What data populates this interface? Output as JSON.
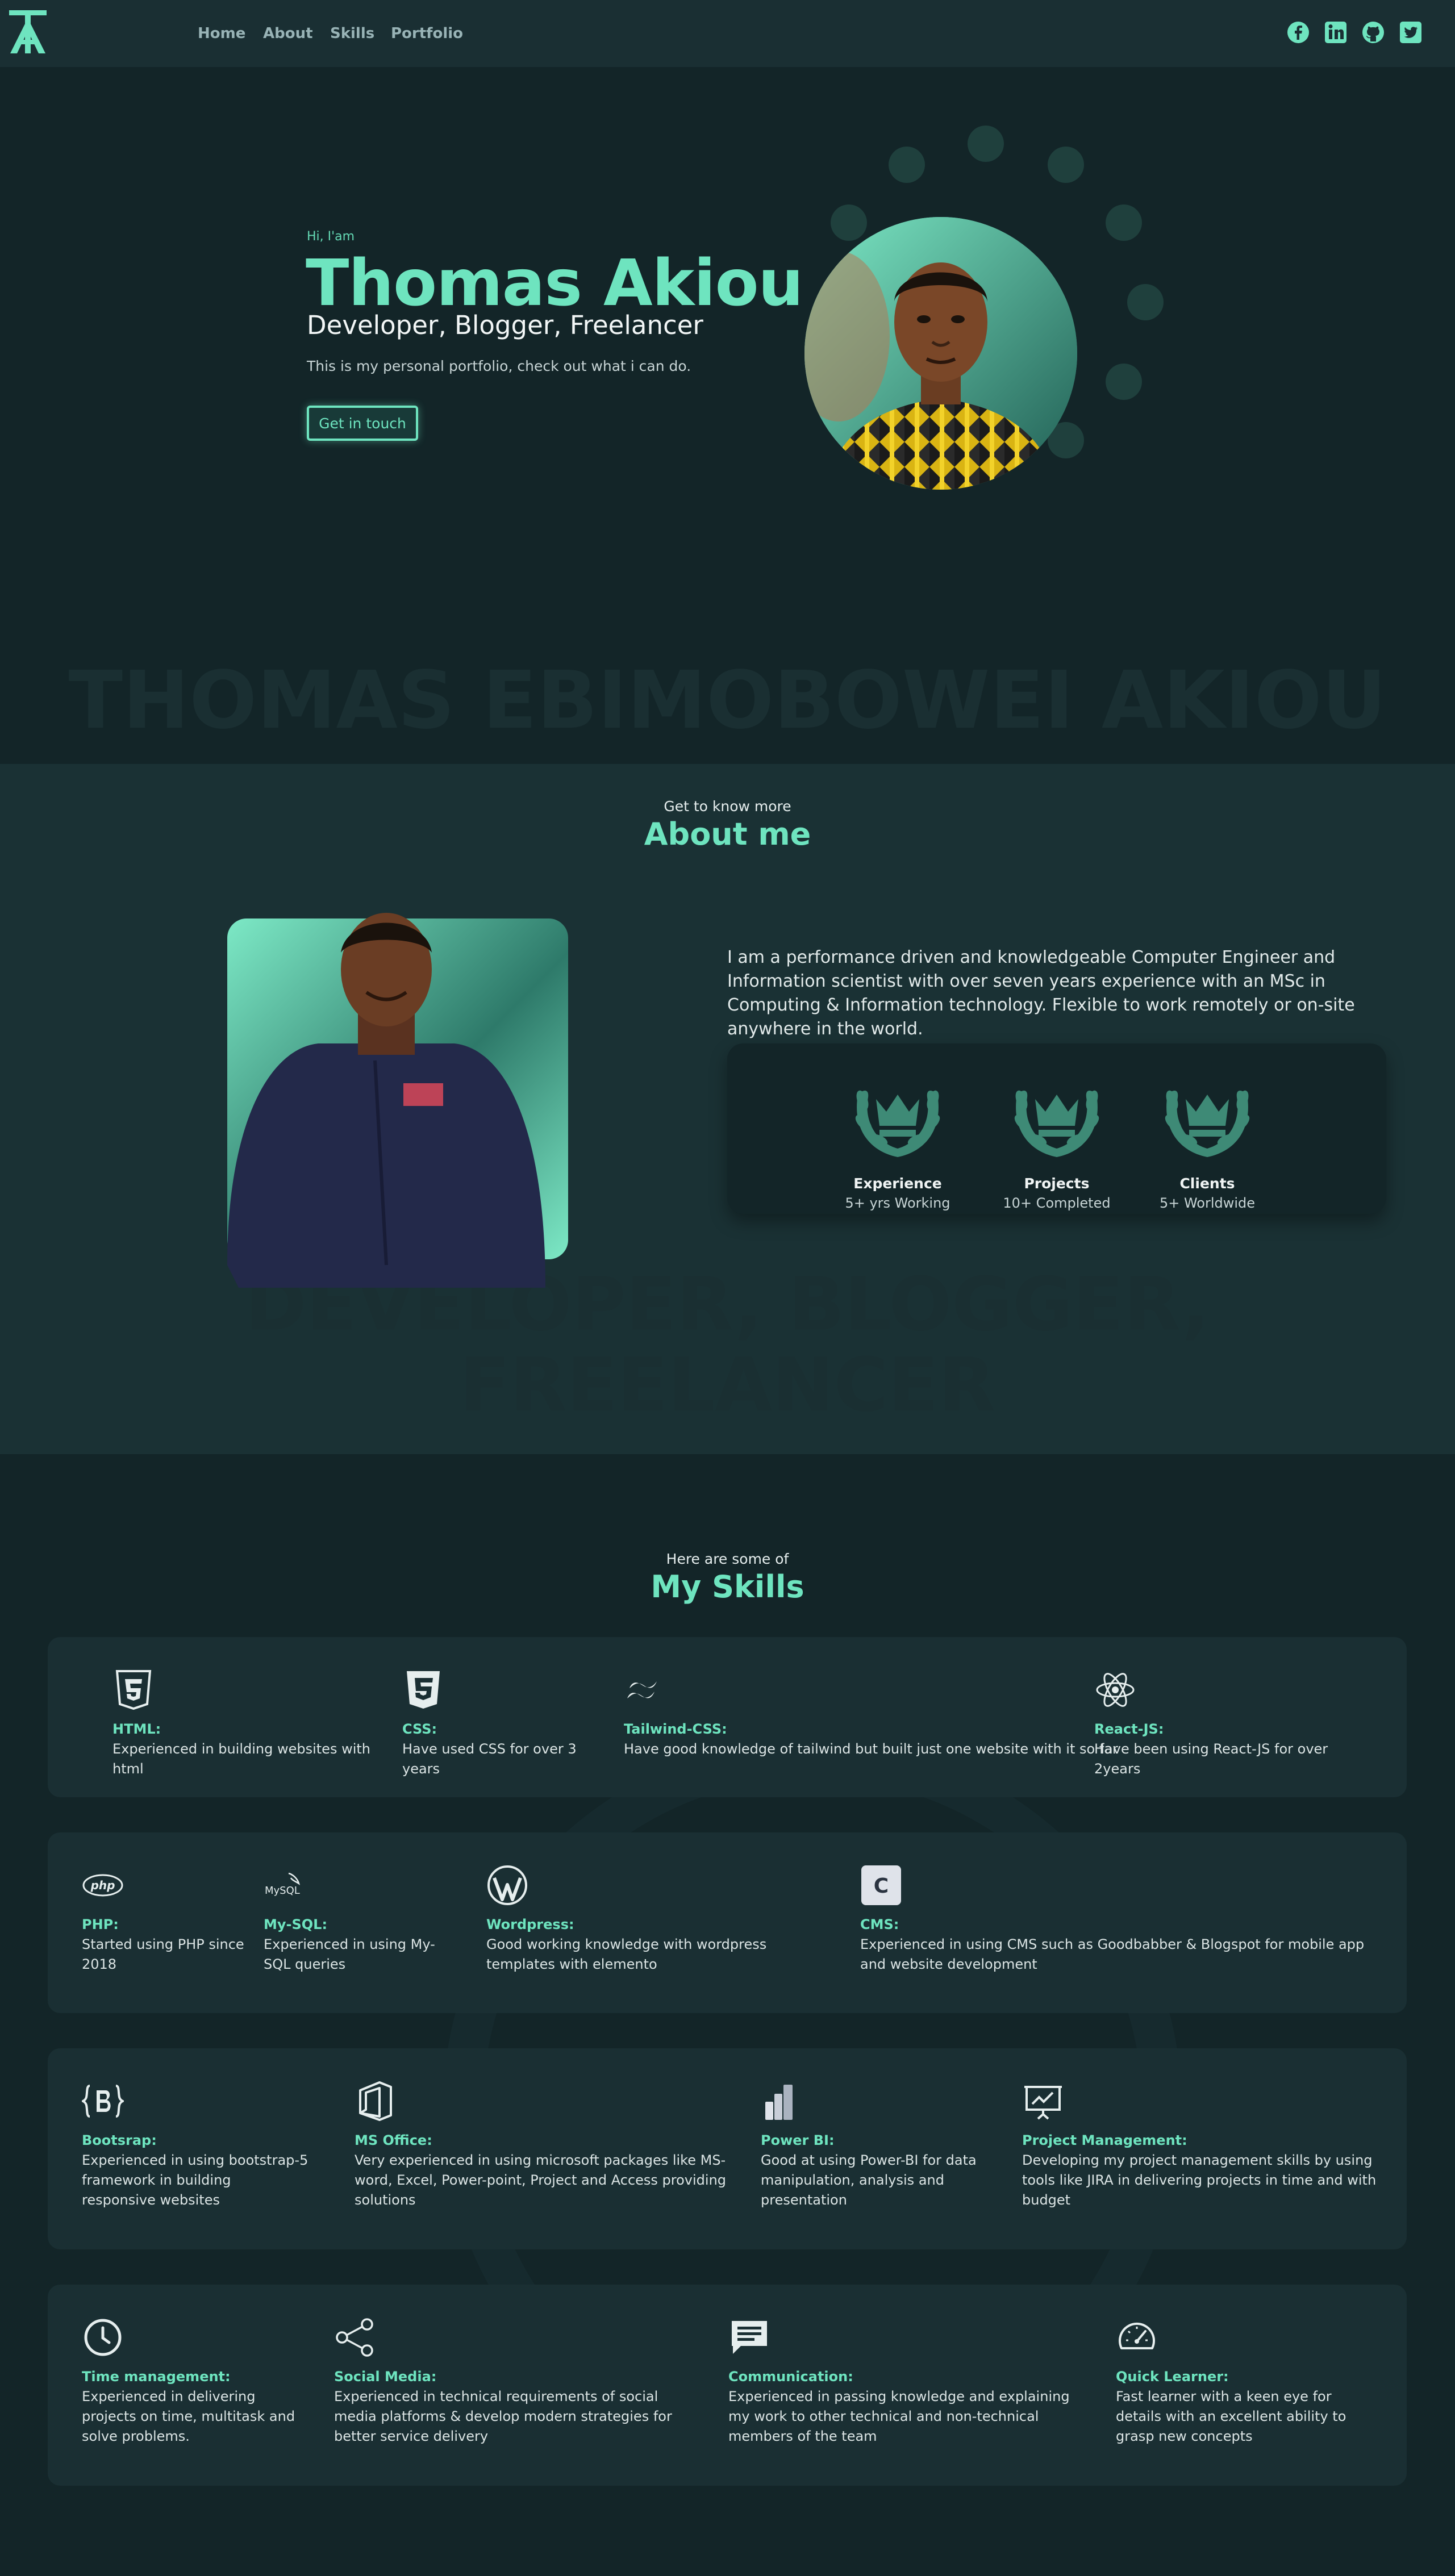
{
  "nav": {
    "logo_text": "TA",
    "links": [
      "Home",
      "About",
      "Skills",
      "Portfolio"
    ],
    "social_icons": [
      "facebook-icon",
      "linkedin-icon",
      "github-icon",
      "twitter-icon"
    ]
  },
  "hero": {
    "greeting": "Hi, I'am",
    "name": "Thomas Akiou",
    "roles": "Developer, Blogger, Freelancer",
    "intro": "This is my personal portfolio, check out what i can do.",
    "cta": "Get in touch",
    "watermark": "THOMAS EBIMOBOWEI AKIOU"
  },
  "about": {
    "pretitle": "Get to know more",
    "title": "About me",
    "paragraph": "I am a performance driven and knowledgeable Computer Engineer and Information scientist with over seven years experience with an MSc in Computing & Information technology. Flexible to work remotely or on-site anywhere in the world.",
    "stats": [
      {
        "title": "Experience",
        "sub": "5+ yrs Working"
      },
      {
        "title": "Projects",
        "sub": "10+ Completed"
      },
      {
        "title": "Clients",
        "sub": "5+ Worldwide"
      }
    ],
    "watermark_line1": "DEVELOPER, BLOGGER,",
    "watermark_line2": "FREELANCER"
  },
  "skills": {
    "pretitle": "Here are some of",
    "title": "My Skills",
    "row1": [
      {
        "name": "HTML:",
        "desc": "Experienced in building websites with html",
        "icon": "html5-icon"
      },
      {
        "name": "CSS:",
        "desc": "Have used CSS for over 3 years",
        "icon": "css3-icon"
      },
      {
        "name": "Tailwind-CSS:",
        "desc": "Have good knowledge of tailwind but built just one website with it so far",
        "icon": "tailwind-icon"
      },
      {
        "name": "React-JS:",
        "desc": "Have been using React-JS for over 2years",
        "icon": "react-icon"
      }
    ],
    "row2": [
      {
        "name": "PHP:",
        "desc": "Started using PHP since 2018",
        "icon": "php-icon",
        "logo": "php"
      },
      {
        "name": "My-SQL:",
        "desc": "Experienced in using My-SQL queries",
        "icon": "mysql-icon",
        "logo": "MySQL"
      },
      {
        "name": "Wordpress:",
        "desc": "Good working knowledge with wordpress templates with elemento",
        "icon": "wordpress-icon"
      },
      {
        "name": "CMS:",
        "desc": "Experienced in using CMS such as Goodbabber & Blogspot for mobile app and website development",
        "icon": "cms-icon",
        "logo": "C"
      }
    ],
    "row3": [
      {
        "name": "Bootsrap:",
        "desc": "Experienced in using bootstrap-5 framework in building responsive websites",
        "icon": "bootstrap-icon"
      },
      {
        "name": "MS Office:",
        "desc": "Very experienced in using microsoft packages like MS-word, Excel, Power-point, Project and Access providing solutions",
        "icon": "ms-office-icon"
      },
      {
        "name": "Power BI:",
        "desc": "Good at using Power-BI for data manipulation, analysis and presentation",
        "icon": "power-bi-icon"
      },
      {
        "name": "Project Management:",
        "desc": "Developing my project management skills by using tools like JIRA in delivering projects in time and with budget",
        "icon": "presentation-chart-icon"
      }
    ],
    "row4": [
      {
        "name": "Time management:",
        "desc": "Experienced in delivering projects on time, multitask and solve problems.",
        "icon": "clock-icon"
      },
      {
        "name": "Social Media:",
        "desc": "Experienced in technical requirements of social media platforms & develop modern strategies for better service delivery",
        "icon": "share-icon"
      },
      {
        "name": "Communication:",
        "desc": "Experienced in passing knowledge and explaining my work to other technical and non-technical members of the team",
        "icon": "chat-icon"
      },
      {
        "name": "Quick Learner:",
        "desc": "Fast learner with a keen eye for details with an excellent ability to grasp new concepts",
        "icon": "speedometer-icon"
      }
    ]
  },
  "colors": {
    "accent": "#6ee4bf",
    "background": "#132528",
    "card": "#1a2f33"
  }
}
